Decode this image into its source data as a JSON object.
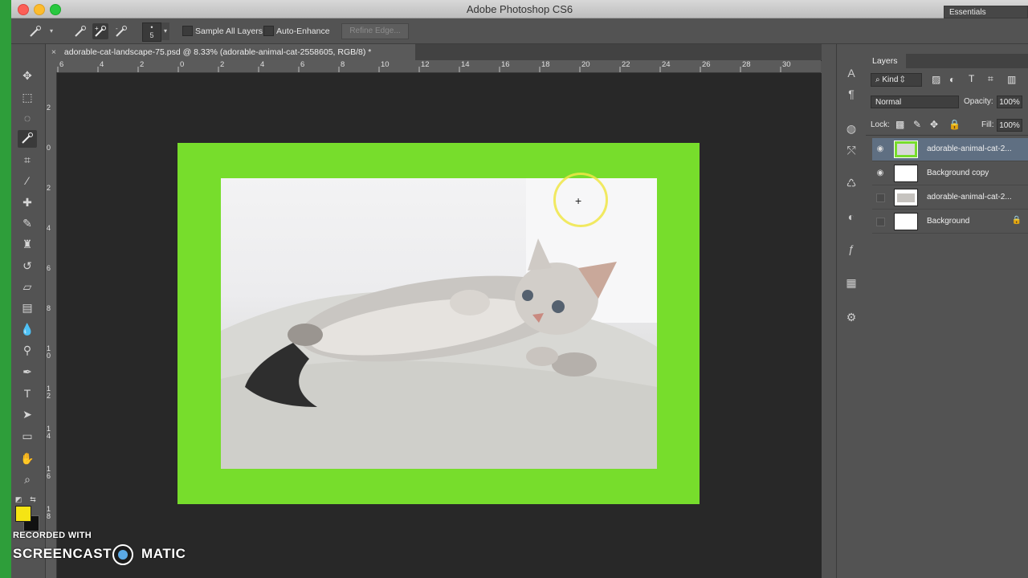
{
  "window": {
    "title": "Adobe Photoshop CS6"
  },
  "options_bar": {
    "brush_size": "5",
    "sample_all_layers": "Sample All Layers",
    "auto_enhance": "Auto-Enhance",
    "refine_edge": "Refine Edge...",
    "workspace": "Essentials"
  },
  "document": {
    "tab_title": "adorable-cat-landscape-75.psd @ 8.33% (adorable-animal-cat-2558605, RGB/8) *",
    "close_glyph": "×",
    "ruler_top": [
      "6",
      "4",
      "2",
      "0",
      "2",
      "4",
      "6",
      "8",
      "10",
      "12",
      "14",
      "16",
      "18",
      "20",
      "22",
      "24",
      "26",
      "28",
      "30"
    ],
    "ruler_left": [
      "2",
      "0",
      "2",
      "4",
      "6",
      "8",
      "1 0",
      "1 2",
      "1 4",
      "1 6",
      "1 8"
    ]
  },
  "layers_panel": {
    "tab": "Layers",
    "filter_kind": "Kind",
    "blend_mode": "Normal",
    "opacity_label": "Opacity:",
    "opacity_value": "100%",
    "lock_label": "Lock:",
    "fill_label": "Fill:",
    "fill_value": "100%",
    "layers": [
      {
        "name": "adorable-animal-cat-2...",
        "visible": true,
        "selected": true
      },
      {
        "name": "Background copy",
        "visible": true,
        "selected": false
      },
      {
        "name": "adorable-animal-cat-2...",
        "visible": false,
        "selected": false
      },
      {
        "name": "Background",
        "visible": false,
        "selected": false,
        "locked": true
      }
    ]
  },
  "colors": {
    "canvas_green": "#77dd2c",
    "foreground": "#f5e414",
    "background": "#111111",
    "selected_layer": "#5f6f82"
  },
  "watermark": {
    "line1": "RECORDED WITH",
    "word1": "SCREENCAST",
    "word2": "MATIC"
  }
}
